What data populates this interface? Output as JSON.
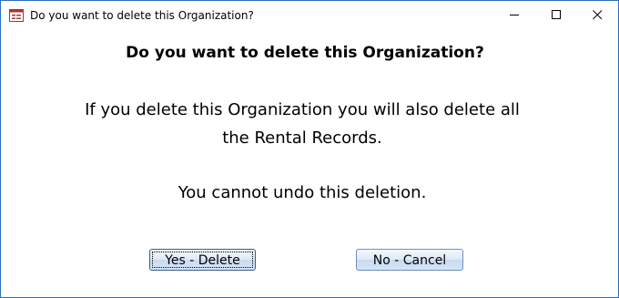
{
  "window": {
    "title": "Do you want to delete this Organization?",
    "app_icon": "access-form-icon",
    "controls": [
      "minimize-icon",
      "maximize-icon",
      "close-icon"
    ]
  },
  "dialog": {
    "heading": "Do you want to delete this Organization?",
    "message_line1": "If you delete this Organization you will also delete all",
    "message_line2": "the Rental Records.",
    "message_line3": "You cannot undo this deletion."
  },
  "buttons": {
    "yes_label": "Yes - Delete",
    "no_label": "No - Cancel"
  },
  "colors": {
    "window_border": "#2b6fc4",
    "button_face": "#dde9f7",
    "button_border": "#6f8fb8"
  }
}
